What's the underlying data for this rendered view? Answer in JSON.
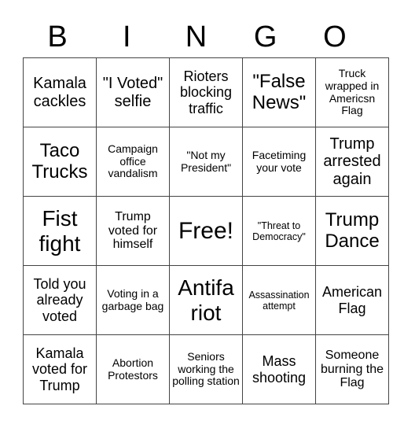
{
  "header": {
    "letters": [
      "B",
      "I",
      "N",
      "G",
      "O"
    ]
  },
  "board": {
    "rows": [
      [
        "Kamala cackles",
        "\"I Voted\" selfie",
        "Rioters blocking traffic",
        "\"False News\"",
        "Truck wrapped in Americsn Flag"
      ],
      [
        "Taco Trucks",
        "Campaign office vandalism",
        "\"Not my President\"",
        "Facetiming your vote",
        "Trump arrested again"
      ],
      [
        "Fist fight",
        "Trump voted for himself",
        "Free!",
        "\"Threat to Democracy\"",
        "Trump Dance"
      ],
      [
        "Told you already voted",
        "Voting in a garbage bag",
        "Antifa riot",
        "Assassination attempt",
        "American Flag"
      ],
      [
        "Kamala voted for Trump",
        "Abortion Protestors",
        "Seniors working the polling station",
        "Mass shooting",
        "Someone burning the Flag"
      ]
    ],
    "free_space": "Free!"
  }
}
